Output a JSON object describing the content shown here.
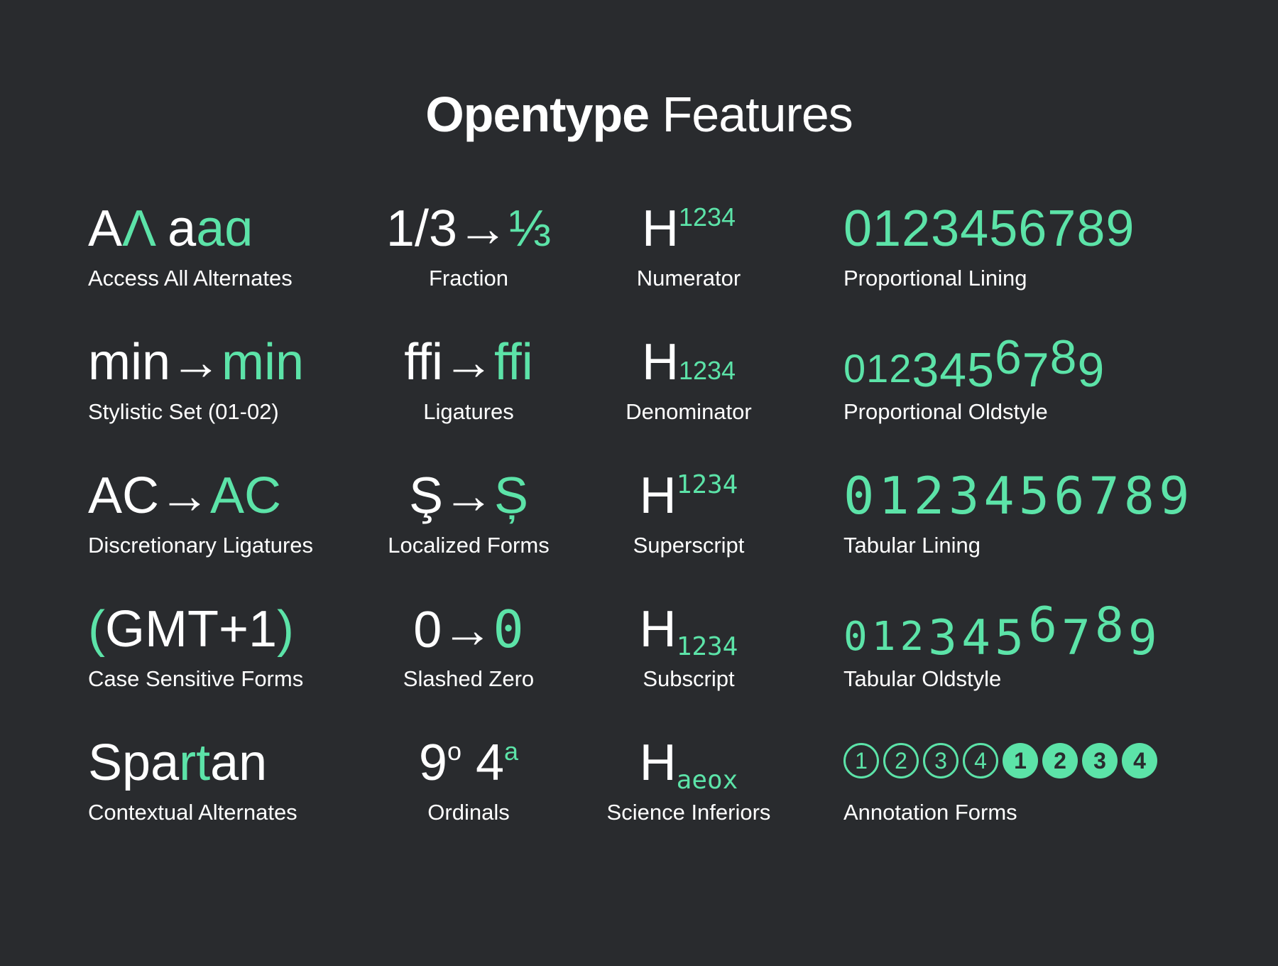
{
  "title": {
    "bold": "Opentype",
    "light": "Features"
  },
  "accent_color": "#5ce3a8",
  "background_color": "#292b2e",
  "col1": {
    "aalt": {
      "plain": "A",
      "alt1": "Λ",
      "plain2": "a",
      "alt2": "a",
      "alt3": "ɑ",
      "label": "Access All Alternates"
    },
    "ss": {
      "plain": "min",
      "arrow": "→",
      "alt": "min",
      "label": "Stylistic Set (01-02)"
    },
    "dlig": {
      "plain": "AC",
      "arrow": "→",
      "alt": "AC",
      "label": "Discretionary Ligatures"
    },
    "case": {
      "open": "(",
      "middle": "GMT+1",
      "close": ")",
      "label": "Case Sensitive Forms"
    },
    "calt": {
      "plain1": "Spa",
      "alt": "rt",
      "plain2": "an",
      "label": "Contextual Alternates"
    }
  },
  "col2": {
    "frac": {
      "plain": "1/3",
      "arrow": "→",
      "alt": "⅓",
      "label": "Fraction"
    },
    "liga": {
      "plain": "ffi",
      "arrow": "→",
      "alt": "ffi",
      "label": "Ligatures"
    },
    "locl": {
      "plain": "Ş",
      "arrow": "→",
      "alt": "Ș",
      "label": "Localized Forms"
    },
    "zero": {
      "plain": "0",
      "arrow": "→",
      "alt": "0",
      "label": "Slashed Zero"
    },
    "ordn": {
      "base1": "9",
      "ord1": "o",
      "base2": "4",
      "ord2": "a",
      "label": "Ordinals"
    }
  },
  "col3": {
    "numr": {
      "base": "H",
      "fig": "1234",
      "label": "Numerator"
    },
    "dnom": {
      "base": "H",
      "fig": "1234",
      "label": "Denominator"
    },
    "sups": {
      "base": "H",
      "fig": "1234",
      "label": "Superscript"
    },
    "subs": {
      "base": "H",
      "fig": "1234",
      "label": "Subscript"
    },
    "sinf": {
      "base": "H",
      "fig": "aeox",
      "label": "Science Inferiors"
    }
  },
  "col4": {
    "pnum_lnum": {
      "digits": "0123456789",
      "label": "Proportional Lining"
    },
    "pnum_onum": {
      "digits": [
        "0",
        "1",
        "2",
        "3",
        "4",
        "5",
        "6",
        "7",
        "8",
        "9"
      ],
      "label": "Proportional Oldstyle"
    },
    "tnum_lnum": {
      "digits": "0123456789",
      "label": "Tabular Lining"
    },
    "tnum_onum": {
      "digits": [
        "0",
        "1",
        "2",
        "3",
        "4",
        "5",
        "6",
        "7",
        "8",
        "9"
      ],
      "label": "Tabular Oldstyle"
    },
    "nalt": {
      "outline": [
        "1",
        "2",
        "3",
        "4"
      ],
      "filled": [
        "1",
        "2",
        "3",
        "4"
      ],
      "label": "Annotation Forms"
    }
  }
}
